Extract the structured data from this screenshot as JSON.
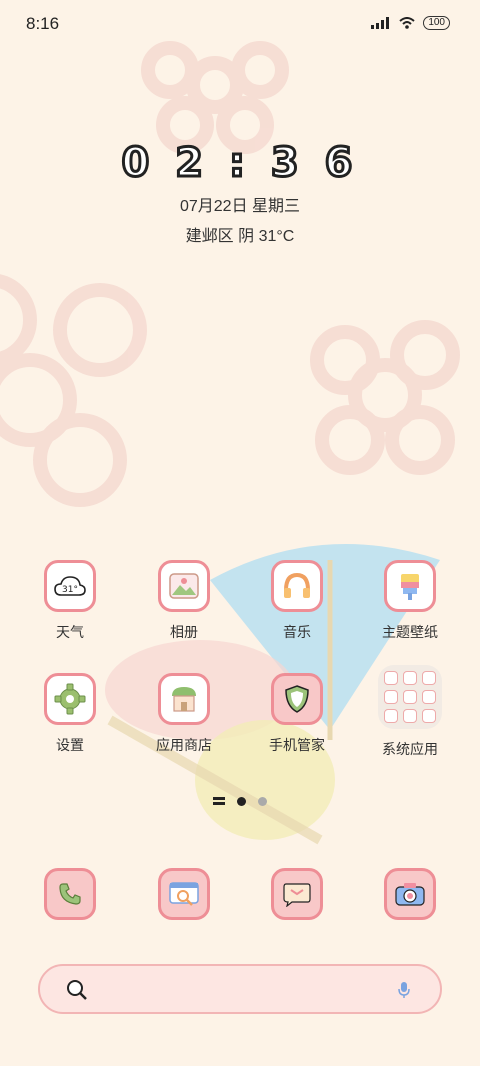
{
  "status_bar": {
    "time": "8:16",
    "battery": "100"
  },
  "lock_clock": {
    "time": "0 2 : 3 6",
    "date": "07月22日 星期三",
    "weather": "建邺区 阴 31°C"
  },
  "weather_icon_value": "31°",
  "apps": [
    {
      "label": "天气",
      "icon": "weather-cloud-icon"
    },
    {
      "label": "相册",
      "icon": "gallery-icon"
    },
    {
      "label": "音乐",
      "icon": "headphones-icon"
    },
    {
      "label": "主题壁纸",
      "icon": "paint-brush-icon"
    },
    {
      "label": "设置",
      "icon": "gear-icon"
    },
    {
      "label": "应用商店",
      "icon": "store-icon"
    },
    {
      "label": "手机管家",
      "icon": "shield-icon"
    },
    {
      "label": "系统应用",
      "icon": "folder-icon"
    }
  ],
  "dock": [
    {
      "icon": "phone-icon"
    },
    {
      "icon": "browser-icon"
    },
    {
      "icon": "messages-icon"
    },
    {
      "icon": "camera-icon"
    }
  ],
  "colors": {
    "background": "#fdf3e7",
    "accent_pink": "#ee8e96",
    "dock_pink": "#f8c8c8"
  }
}
